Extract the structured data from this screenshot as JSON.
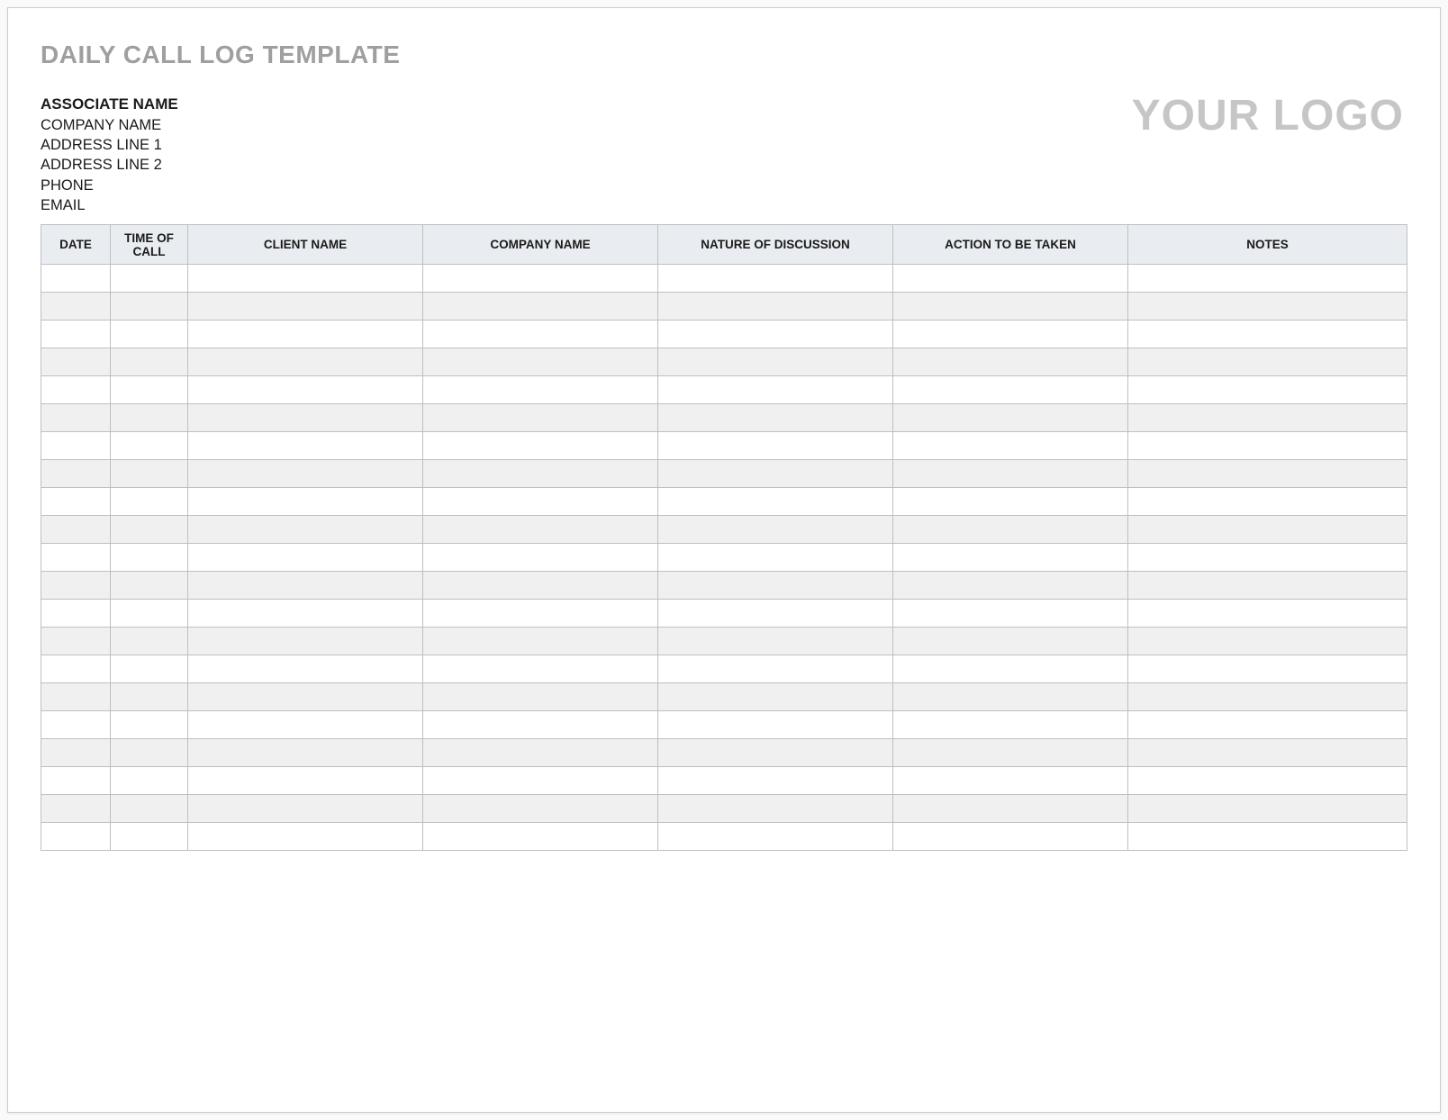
{
  "title": "DAILY CALL LOG TEMPLATE",
  "associate": {
    "name": "ASSOCIATE NAME",
    "company": "COMPANY NAME",
    "address1": "ADDRESS LINE 1",
    "address2": "ADDRESS LINE 2",
    "phone": "PHONE",
    "email": "EMAIL"
  },
  "logo_text": "YOUR LOGO",
  "table": {
    "headers": {
      "date": "DATE",
      "time": "TIME OF CALL",
      "client": "CLIENT NAME",
      "company": "COMPANY NAME",
      "nature": "NATURE OF DISCUSSION",
      "action": "ACTION TO BE TAKEN",
      "notes": "NOTES"
    },
    "rows": [
      {
        "date": "",
        "time": "",
        "client": "",
        "company": "",
        "nature": "",
        "action": "",
        "notes": ""
      },
      {
        "date": "",
        "time": "",
        "client": "",
        "company": "",
        "nature": "",
        "action": "",
        "notes": ""
      },
      {
        "date": "",
        "time": "",
        "client": "",
        "company": "",
        "nature": "",
        "action": "",
        "notes": ""
      },
      {
        "date": "",
        "time": "",
        "client": "",
        "company": "",
        "nature": "",
        "action": "",
        "notes": ""
      },
      {
        "date": "",
        "time": "",
        "client": "",
        "company": "",
        "nature": "",
        "action": "",
        "notes": ""
      },
      {
        "date": "",
        "time": "",
        "client": "",
        "company": "",
        "nature": "",
        "action": "",
        "notes": ""
      },
      {
        "date": "",
        "time": "",
        "client": "",
        "company": "",
        "nature": "",
        "action": "",
        "notes": ""
      },
      {
        "date": "",
        "time": "",
        "client": "",
        "company": "",
        "nature": "",
        "action": "",
        "notes": ""
      },
      {
        "date": "",
        "time": "",
        "client": "",
        "company": "",
        "nature": "",
        "action": "",
        "notes": ""
      },
      {
        "date": "",
        "time": "",
        "client": "",
        "company": "",
        "nature": "",
        "action": "",
        "notes": ""
      },
      {
        "date": "",
        "time": "",
        "client": "",
        "company": "",
        "nature": "",
        "action": "",
        "notes": ""
      },
      {
        "date": "",
        "time": "",
        "client": "",
        "company": "",
        "nature": "",
        "action": "",
        "notes": ""
      },
      {
        "date": "",
        "time": "",
        "client": "",
        "company": "",
        "nature": "",
        "action": "",
        "notes": ""
      },
      {
        "date": "",
        "time": "",
        "client": "",
        "company": "",
        "nature": "",
        "action": "",
        "notes": ""
      },
      {
        "date": "",
        "time": "",
        "client": "",
        "company": "",
        "nature": "",
        "action": "",
        "notes": ""
      },
      {
        "date": "",
        "time": "",
        "client": "",
        "company": "",
        "nature": "",
        "action": "",
        "notes": ""
      },
      {
        "date": "",
        "time": "",
        "client": "",
        "company": "",
        "nature": "",
        "action": "",
        "notes": ""
      },
      {
        "date": "",
        "time": "",
        "client": "",
        "company": "",
        "nature": "",
        "action": "",
        "notes": ""
      },
      {
        "date": "",
        "time": "",
        "client": "",
        "company": "",
        "nature": "",
        "action": "",
        "notes": ""
      },
      {
        "date": "",
        "time": "",
        "client": "",
        "company": "",
        "nature": "",
        "action": "",
        "notes": ""
      },
      {
        "date": "",
        "time": "",
        "client": "",
        "company": "",
        "nature": "",
        "action": "",
        "notes": ""
      }
    ]
  }
}
